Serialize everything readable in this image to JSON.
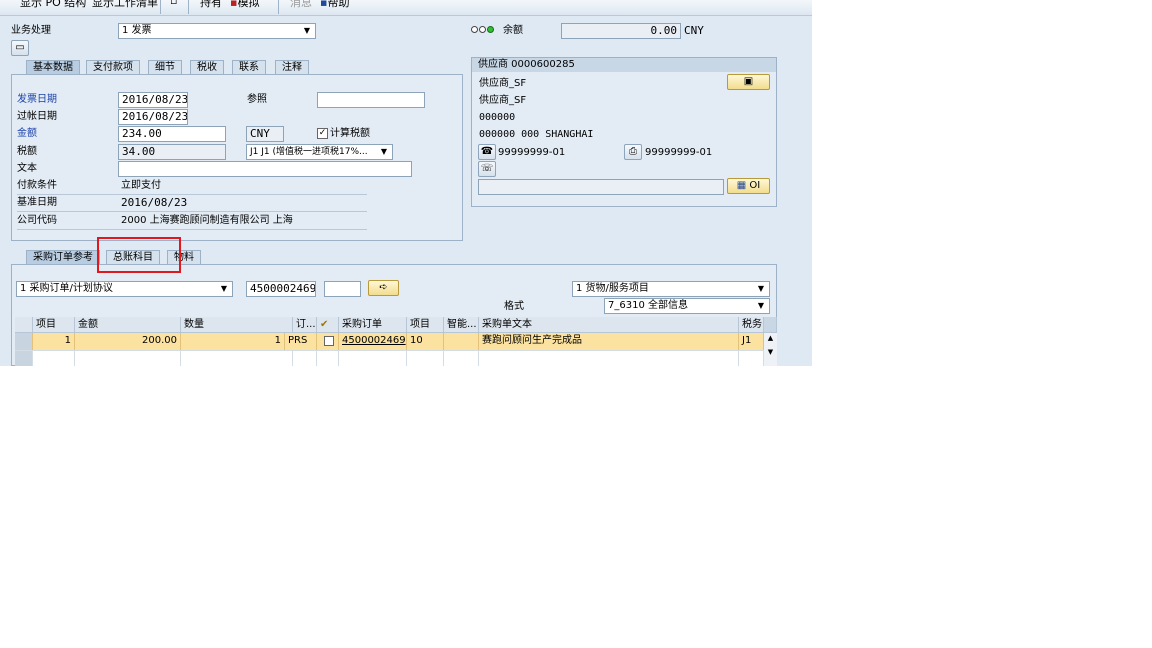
{
  "toolbar": {
    "show_po_structure": "显示 PO 结构",
    "show_worklist": "显示工作清单",
    "hold": "持有",
    "simulate": "模拟",
    "messages": "消息",
    "help": "帮助"
  },
  "header": {
    "transaction_label": "业务处理",
    "transaction_value": "1 发票",
    "balance_label": "余额",
    "balance_value": "0.00",
    "balance_currency": "CNY"
  },
  "basic_tabs": [
    "基本数据",
    "支付款项",
    "细节",
    "税收",
    "联系",
    "注释"
  ],
  "basic": {
    "invoice_date_label": "发票日期",
    "invoice_date": "2016/08/23",
    "reference_label": "参照",
    "reference": "",
    "posting_date_label": "过帐日期",
    "posting_date": "2016/08/23",
    "amount_label": "金额",
    "amount": "234.00",
    "currency": "CNY",
    "calc_tax_label": "计算税额",
    "calc_tax_checked": "✓",
    "tax_amount_label": "税额",
    "tax_amount": "34.00",
    "tax_code": "J1 J1 (增值税一进项税17%...",
    "text_label": "文本",
    "text": "",
    "payment_terms_label": "付款条件",
    "payment_terms": "立即支付",
    "baseline_date_label": "基准日期",
    "baseline_date": "2016/08/23",
    "company_code_label": "公司代码",
    "company_code": "2000 上海赛跑顾问制造有限公司 上海"
  },
  "vendor": {
    "title": "供应商 0000600285",
    "name1": "供应商_SF",
    "name2": "供应商_SF",
    "postal": "000000",
    "city": "000000 000 SHANGHAI",
    "phone": "99999999-01",
    "fax": "99999999-01",
    "oi_button": "OI"
  },
  "ref_tabs": [
    "采购订单参考",
    "总账科目",
    "物料"
  ],
  "ref": {
    "ref_type": "1 采购订单/计划协议",
    "po_number": "4500002469",
    "po_item": "",
    "item_category": "1 货物/服务项目",
    "layout_label": "格式",
    "layout": "7_6310 全部信息"
  },
  "grid": {
    "columns": [
      "项目",
      "金额",
      "数量",
      "订...",
      "",
      "采购订单",
      "项目",
      "智能...",
      "采购单文本",
      "税务"
    ],
    "rows": [
      {
        "item": "1",
        "amount": "200.00",
        "qty": "1",
        "uom": "PRS",
        "checked": "",
        "po": "4500002469",
        "po_item": "10",
        "smart": "",
        "text": "赛跑问顾问生产完成品",
        "tax": "J1"
      }
    ]
  },
  "colors": {
    "background": "#dfe9f3",
    "row_highlight": "#fbe2a0",
    "annotation_box": "#e0191e",
    "button_yellow": "#f2dc8d"
  }
}
